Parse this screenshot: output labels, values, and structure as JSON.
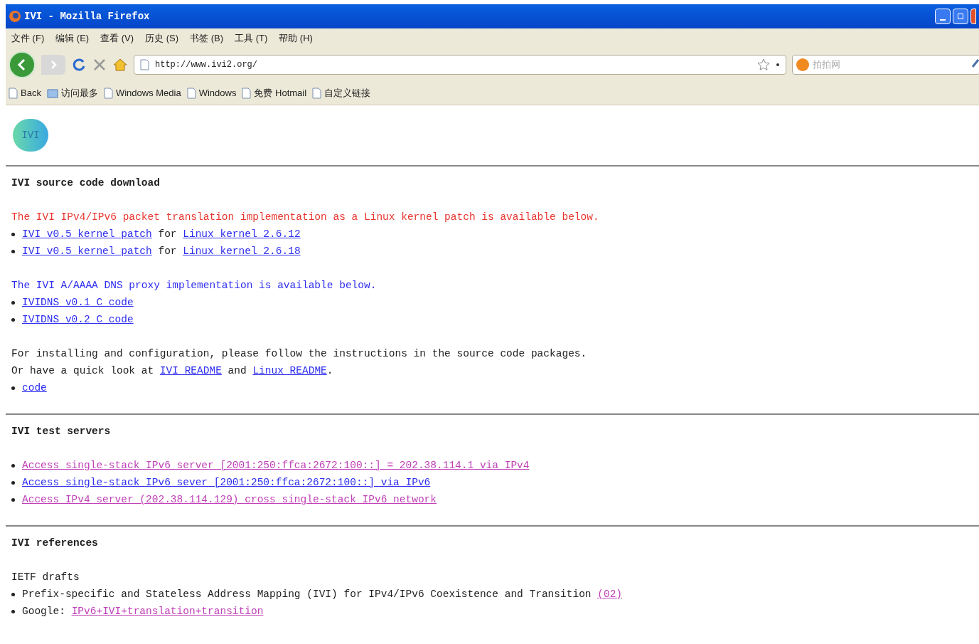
{
  "window": {
    "title": "IVI - Mozilla Firefox"
  },
  "menu": [
    "文件 (F)",
    "编辑 (E)",
    "查看 (V)",
    "历史 (S)",
    "书签 (B)",
    "工具 (T)",
    "帮助 (H)"
  ],
  "address": {
    "value": "http://www.ivi2.org/"
  },
  "search": {
    "placeholder": "拍拍网"
  },
  "bookmarks": [
    {
      "label": "Back",
      "kind": "page"
    },
    {
      "label": "访问最多",
      "kind": "folder"
    },
    {
      "label": "Windows Media",
      "kind": "page"
    },
    {
      "label": "Windows",
      "kind": "page"
    },
    {
      "label": "免费 Hotmail",
      "kind": "page"
    },
    {
      "label": "自定义链接",
      "kind": "page"
    }
  ],
  "logo": {
    "text": "IVI"
  },
  "sections": [
    {
      "heading": "IVI source code download",
      "groups": [
        [
          {
            "kind": "plain",
            "color": "#e8352e",
            "parts": [
              {
                "kind": "text",
                "text": "The IVI IPv4/IPv6 packet translation implementation as a Linux kernel patch is available below."
              }
            ]
          },
          {
            "kind": "bullet",
            "parts": [
              {
                "kind": "link",
                "text": "IVI v0.5 kernel patch"
              },
              {
                "kind": "text",
                "text": " for "
              },
              {
                "kind": "link",
                "text": "Linux kernel 2.6.12"
              }
            ]
          },
          {
            "kind": "bullet",
            "parts": [
              {
                "kind": "link",
                "text": "IVI v0.5 kernel patch"
              },
              {
                "kind": "text",
                "text": " for "
              },
              {
                "kind": "link",
                "text": "Linux kernel 2.6.18"
              }
            ]
          }
        ],
        [
          {
            "kind": "plain",
            "color": "#2d2df0",
            "parts": [
              {
                "kind": "text",
                "text": "The IVI A/AAAA DNS proxy implementation is available below."
              }
            ]
          },
          {
            "kind": "bullet",
            "parts": [
              {
                "kind": "link",
                "text": "IVIDNS v0.1 C code"
              }
            ]
          },
          {
            "kind": "bullet",
            "parts": [
              {
                "kind": "link",
                "text": "IVIDNS v0.2 C code"
              }
            ]
          }
        ],
        [
          {
            "kind": "plain",
            "color": "#222222",
            "parts": [
              {
                "kind": "text",
                "text": "For installing and configuration, please follow the instructions in the source code packages."
              }
            ]
          },
          {
            "kind": "plain",
            "color": "#222222",
            "parts": [
              {
                "kind": "text",
                "text": "Or have a quick look at "
              },
              {
                "kind": "link",
                "text": "IVI README"
              },
              {
                "kind": "text",
                "text": " and "
              },
              {
                "kind": "link",
                "text": "Linux README"
              },
              {
                "kind": "text",
                "text": "."
              }
            ]
          },
          {
            "kind": "bullet",
            "parts": [
              {
                "kind": "link",
                "text": "code"
              }
            ]
          }
        ]
      ]
    },
    {
      "heading": "IVI test servers",
      "groups": [
        [
          {
            "kind": "bullet",
            "parts": [
              {
                "kind": "visited-link",
                "text": "Access single-stack IPv6 server [2001:250:ffca:2672:100::] = 202.38.114.1 via IPv4"
              }
            ]
          },
          {
            "kind": "bullet",
            "parts": [
              {
                "kind": "link",
                "text": "Access single-stack IPv6 sever [2001:250:ffca:2672:100::] via IPv6"
              }
            ]
          },
          {
            "kind": "bullet",
            "parts": [
              {
                "kind": "visited-link",
                "text": "Access IPv4 server (202.38.114.129) cross single-stack IPv6 network"
              }
            ]
          }
        ]
      ]
    },
    {
      "heading": "IVI references",
      "groups": [
        [
          {
            "kind": "plain",
            "color": "#222222",
            "parts": [
              {
                "kind": "text",
                "text": "IETF drafts"
              }
            ]
          },
          {
            "kind": "bullet",
            "parts": [
              {
                "kind": "text",
                "text": "Prefix-specific and Stateless Address Mapping (IVI) for IPv4/IPv6 Coexistence and Transition "
              },
              {
                "kind": "visited-link",
                "text": "(02)"
              }
            ]
          },
          {
            "kind": "bullet",
            "parts": [
              {
                "kind": "text",
                "text": "Google: "
              },
              {
                "kind": "visited-link",
                "text": "IPv6+IVI+translation+transition"
              }
            ]
          }
        ]
      ]
    }
  ]
}
